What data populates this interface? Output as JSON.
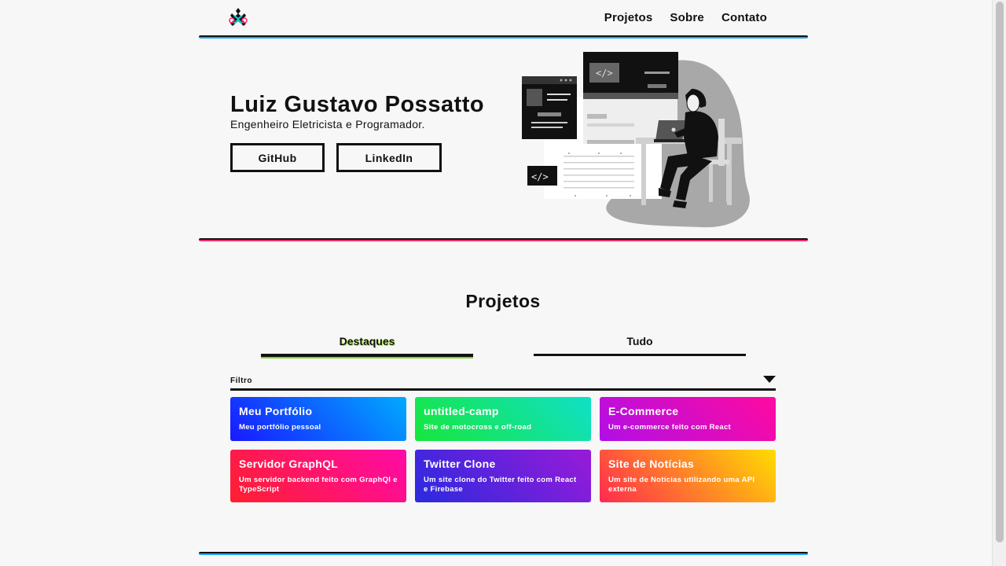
{
  "header": {
    "logo_icon": "cross-diamond-logo-icon",
    "nav": [
      "Projetos",
      "Sobre",
      "Contato"
    ]
  },
  "hero": {
    "name": "Luiz Gustavo Possatto",
    "subtitle": "Engenheiro Eletricista e Programador.",
    "buttons": {
      "github": "GitHub",
      "linkedin": "LinkedIn"
    },
    "illustration_icon": "developer-at-desk-illustration"
  },
  "projects": {
    "title": "Projetos",
    "tabs": {
      "highlights": "Destaques",
      "all": "Tudo"
    },
    "active_tab": "Destaques",
    "filter_label": "Filtro",
    "cards": [
      {
        "title": "Meu Portfólio",
        "description": "Meu portfólio pessoal",
        "colors": [
          "#1919ff",
          "#00aaff"
        ]
      },
      {
        "title": "untitled-camp",
        "description": "Site de motocross e off-road",
        "colors": [
          "#17e63c",
          "#10e0c8"
        ]
      },
      {
        "title": "E-Commerce",
        "description": "Um e-commerce feito com React",
        "colors": [
          "#b00fe6",
          "#ff0aa0"
        ]
      },
      {
        "title": "Servidor GraphQL",
        "description": "Um servidor backend feito com GraphQl e TypeScript",
        "colors": [
          "#ff1f2f",
          "#ff0aa8"
        ]
      },
      {
        "title": "Twitter Clone",
        "description": "Um site clone do Twitter feito com React e Firebase",
        "colors": [
          "#2a2adf",
          "#9a1ad8"
        ]
      },
      {
        "title": "Site de Notícias",
        "description": "Um site de Notícias utilizando uma API externa",
        "colors": [
          "#ff2a4f",
          "#ffdd00"
        ]
      }
    ]
  },
  "colors": {
    "background": "#f7f7f7",
    "text": "#111111",
    "accent_blue": "#1aa7ff",
    "accent_pink": "#ff2d6a",
    "accent_green": "#7fd42a"
  }
}
